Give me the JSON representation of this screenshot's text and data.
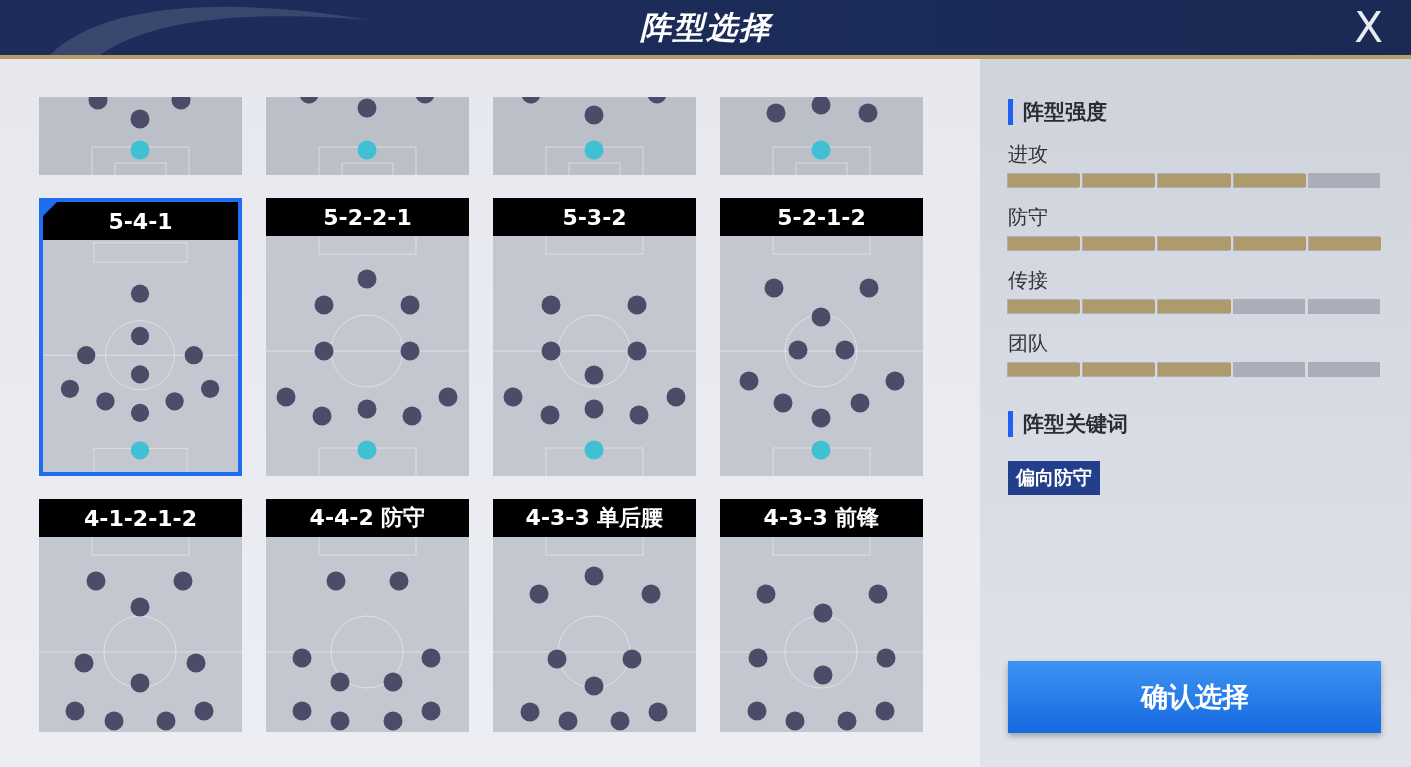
{
  "header": {
    "title": "阵型选择",
    "close": "X"
  },
  "partial_cards": [
    {
      "selected": false
    },
    {
      "selected": false
    },
    {
      "selected": false
    },
    {
      "selected": false
    }
  ],
  "formations": [
    {
      "label": "5-4-1",
      "selected": true
    },
    {
      "label": "5-2-2-1",
      "selected": false
    },
    {
      "label": "5-3-2",
      "selected": false
    },
    {
      "label": "5-2-1-2",
      "selected": false
    },
    {
      "label": "4-1-2-1-2",
      "selected": false
    },
    {
      "label": "4-4-2 防守",
      "selected": false
    },
    {
      "label": "4-3-3 单后腰",
      "selected": false
    },
    {
      "label": "4-3-3 前锋",
      "selected": false
    }
  ],
  "strength": {
    "title": "阵型强度",
    "stats": [
      {
        "label": "进攻",
        "level": 0.8
      },
      {
        "label": "防守",
        "level": 1
      },
      {
        "label": "传接",
        "level": 0.6
      },
      {
        "label": "团队",
        "level": 0.6
      }
    ]
  },
  "keywords": {
    "title": "阵型关键词",
    "tags": [
      "偏向防守"
    ]
  },
  "confirm_button": "确认选择"
}
